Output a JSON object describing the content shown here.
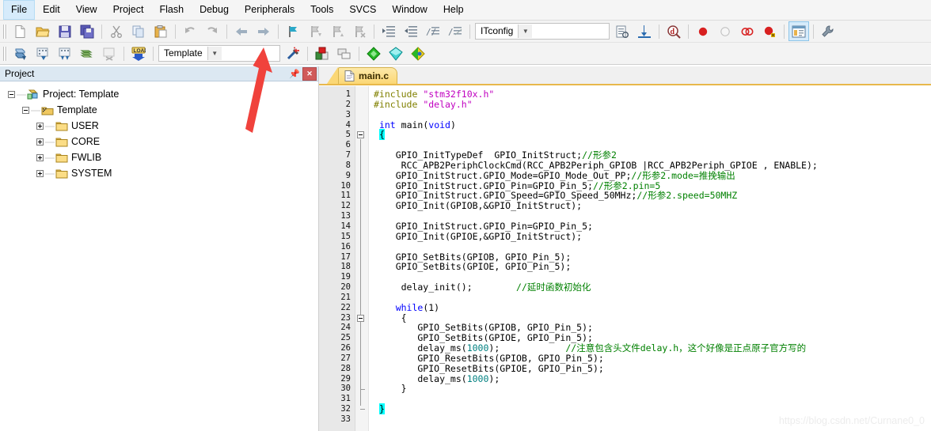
{
  "menu": {
    "items": [
      {
        "label": "File",
        "active": true
      },
      {
        "label": "Edit",
        "active": false
      },
      {
        "label": "View",
        "active": false
      },
      {
        "label": "Project",
        "active": false
      },
      {
        "label": "Flash",
        "active": false
      },
      {
        "label": "Debug",
        "active": false
      },
      {
        "label": "Peripherals",
        "active": false
      },
      {
        "label": "Tools",
        "active": false
      },
      {
        "label": "SVCS",
        "active": false
      },
      {
        "label": "Window",
        "active": false
      },
      {
        "label": "Help",
        "active": false
      }
    ]
  },
  "toolbar_main": {
    "icons": [
      "new-file-icon",
      "open-file-icon",
      "save-icon",
      "save-all-icon",
      "cut-icon",
      "copy-icon",
      "paste-icon",
      "undo-icon",
      "redo-icon",
      "navigate-back-icon",
      "navigate-forward-icon",
      "bookmark-toggle-icon",
      "bookmark-prev-icon",
      "bookmark-next-icon",
      "bookmark-clear-icon",
      "indent-increase-icon",
      "indent-decrease-icon",
      "comment-lines-icon",
      "uncomment-lines-icon"
    ],
    "search_value": "ITconfig",
    "search_placeholder": "",
    "right_icons": [
      "browse-symbol-icon",
      "find-in-files-icon",
      "find-symbol-icon",
      "insert-breakpoint-icon",
      "disable-breakpoint-icon",
      "remove-all-breakpoints-icon",
      "disable-all-breakpoints-icon",
      "project-window-icon",
      "configure-toolbar-icon"
    ]
  },
  "toolbar_build": {
    "icons": [
      "translate-file-icon",
      "build-target-icon",
      "rebuild-all-icon",
      "batch-build-icon",
      "stop-build-icon",
      "download-icon"
    ],
    "target_value": "Template",
    "wizard_icon": "configuration-wizard-icon",
    "right_icons": [
      "target-options-icon",
      "manage-components-icon",
      "pack-installer-icon",
      "select-software-packs-icon",
      "manage-run-time-icon"
    ]
  },
  "project_pane": {
    "title": "Project",
    "pin_icon": "pin-icon",
    "close_icon": "close-icon",
    "tree": [
      {
        "label": "Project: Template",
        "depth": 0,
        "expander": "minus",
        "icon": "project-icon"
      },
      {
        "label": "Template",
        "depth": 1,
        "expander": "minus",
        "icon": "target-icon"
      },
      {
        "label": "USER",
        "depth": 2,
        "expander": "plus",
        "icon": "folder-icon"
      },
      {
        "label": "CORE",
        "depth": 2,
        "expander": "plus",
        "icon": "folder-icon"
      },
      {
        "label": "FWLIB",
        "depth": 2,
        "expander": "plus",
        "icon": "folder-icon"
      },
      {
        "label": "SYSTEM",
        "depth": 2,
        "expander": "plus",
        "icon": "folder-icon"
      }
    ]
  },
  "editor": {
    "tab_label": "main.c",
    "tab_icon": "c-file-icon",
    "first_line": 1,
    "last_line": 33,
    "lines": [
      {
        "n": 1,
        "tokens": [
          {
            "t": "#include ",
            "c": "p"
          },
          {
            "t": "\"stm32f10x.h\"",
            "c": "s"
          }
        ]
      },
      {
        "n": 2,
        "tokens": [
          {
            "t": "#include ",
            "c": "p"
          },
          {
            "t": "\"delay.h\"",
            "c": "s"
          }
        ]
      },
      {
        "n": 3,
        "tokens": []
      },
      {
        "n": 4,
        "tokens": [
          {
            "t": " ",
            "c": ""
          },
          {
            "t": "int",
            "c": "k"
          },
          {
            "t": " main(",
            "c": ""
          },
          {
            "t": "void",
            "c": "k"
          },
          {
            "t": ")",
            "c": ""
          }
        ]
      },
      {
        "n": 5,
        "tokens": [
          {
            "t": " ",
            "c": ""
          },
          {
            "t": "{",
            "c": "hl"
          }
        ]
      },
      {
        "n": 6,
        "tokens": []
      },
      {
        "n": 7,
        "tokens": [
          {
            "t": "    GPIO_InitTypeDef  GPIO_InitStruct;",
            "c": ""
          },
          {
            "t": "//形参2",
            "c": "c"
          }
        ]
      },
      {
        "n": 8,
        "tokens": [
          {
            "t": "     RCC_APB2PeriphClockCmd(RCC_APB2Periph_GPIOB |RCC_APB2Periph_GPIOE , ENABLE);",
            "c": ""
          }
        ]
      },
      {
        "n": 9,
        "tokens": [
          {
            "t": "    GPIO_InitStruct.GPIO_Mode=GPIO_Mode_Out_PP;",
            "c": ""
          },
          {
            "t": "//形参2.mode=推挽输出",
            "c": "c"
          }
        ]
      },
      {
        "n": 10,
        "tokens": [
          {
            "t": "    GPIO_InitStruct.GPIO_Pin=GPIO_Pin_5;",
            "c": ""
          },
          {
            "t": "//形参2.pin=5",
            "c": "c"
          }
        ]
      },
      {
        "n": 11,
        "tokens": [
          {
            "t": "    GPIO_InitStruct.GPIO_Speed=GPIO_Speed_50MHz;",
            "c": ""
          },
          {
            "t": "//形参2.speed=50MHZ",
            "c": "c"
          }
        ]
      },
      {
        "n": 12,
        "tokens": [
          {
            "t": "    GPIO_Init(GPIOB,&GPIO_InitStruct);",
            "c": ""
          }
        ]
      },
      {
        "n": 13,
        "tokens": []
      },
      {
        "n": 14,
        "tokens": [
          {
            "t": "    GPIO_InitStruct.GPIO_Pin=GPIO_Pin_5;",
            "c": ""
          }
        ]
      },
      {
        "n": 15,
        "tokens": [
          {
            "t": "    GPIO_Init(GPIOE,&GPIO_InitStruct);",
            "c": ""
          }
        ]
      },
      {
        "n": 16,
        "tokens": []
      },
      {
        "n": 17,
        "tokens": [
          {
            "t": "    GPIO_SetBits(GPIOB, GPIO_Pin_5);",
            "c": ""
          }
        ]
      },
      {
        "n": 18,
        "tokens": [
          {
            "t": "    GPIO_SetBits(GPIOE, GPIO_Pin_5);",
            "c": ""
          }
        ]
      },
      {
        "n": 19,
        "tokens": []
      },
      {
        "n": 20,
        "tokens": [
          {
            "t": "     delay_init();        ",
            "c": ""
          },
          {
            "t": "//延时函数初始化",
            "c": "c"
          }
        ]
      },
      {
        "n": 21,
        "tokens": []
      },
      {
        "n": 22,
        "tokens": [
          {
            "t": "    ",
            "c": ""
          },
          {
            "t": "while",
            "c": "k"
          },
          {
            "t": "(1)",
            "c": ""
          }
        ]
      },
      {
        "n": 23,
        "tokens": [
          {
            "t": "     {",
            "c": ""
          }
        ]
      },
      {
        "n": 24,
        "tokens": [
          {
            "t": "        GPIO_SetBits(GPIOB, GPIO_Pin_5);",
            "c": ""
          }
        ]
      },
      {
        "n": 25,
        "tokens": [
          {
            "t": "        GPIO_SetBits(GPIOE, GPIO_Pin_5);",
            "c": ""
          }
        ]
      },
      {
        "n": 26,
        "tokens": [
          {
            "t": "        delay_ms(",
            "c": ""
          },
          {
            "t": "1000",
            "c": "n"
          },
          {
            "t": ");",
            "c": ""
          },
          {
            "t": "            //注意包含头文件delay.h，这个好像是正点原子官方写的",
            "c": "c"
          }
        ]
      },
      {
        "n": 27,
        "tokens": [
          {
            "t": "        GPIO_ResetBits(GPIOB, GPIO_Pin_5);",
            "c": ""
          }
        ]
      },
      {
        "n": 28,
        "tokens": [
          {
            "t": "        GPIO_ResetBits(GPIOE, GPIO_Pin_5);",
            "c": ""
          }
        ]
      },
      {
        "n": 29,
        "tokens": [
          {
            "t": "        delay_ms(",
            "c": ""
          },
          {
            "t": "1000",
            "c": "n"
          },
          {
            "t": ");",
            "c": ""
          }
        ]
      },
      {
        "n": 30,
        "tokens": [
          {
            "t": "     }",
            "c": ""
          }
        ]
      },
      {
        "n": 31,
        "tokens": []
      },
      {
        "n": 32,
        "tokens": [
          {
            "t": " ",
            "c": ""
          },
          {
            "t": "}",
            "c": "hl"
          }
        ]
      },
      {
        "n": 33,
        "tokens": []
      }
    ]
  },
  "annotation": {
    "arrow_color": "#f0423c",
    "points_to": "configuration-wizard-icon"
  },
  "watermark": {
    "text": "https://blog.csdn.net/Curnane0_0"
  }
}
